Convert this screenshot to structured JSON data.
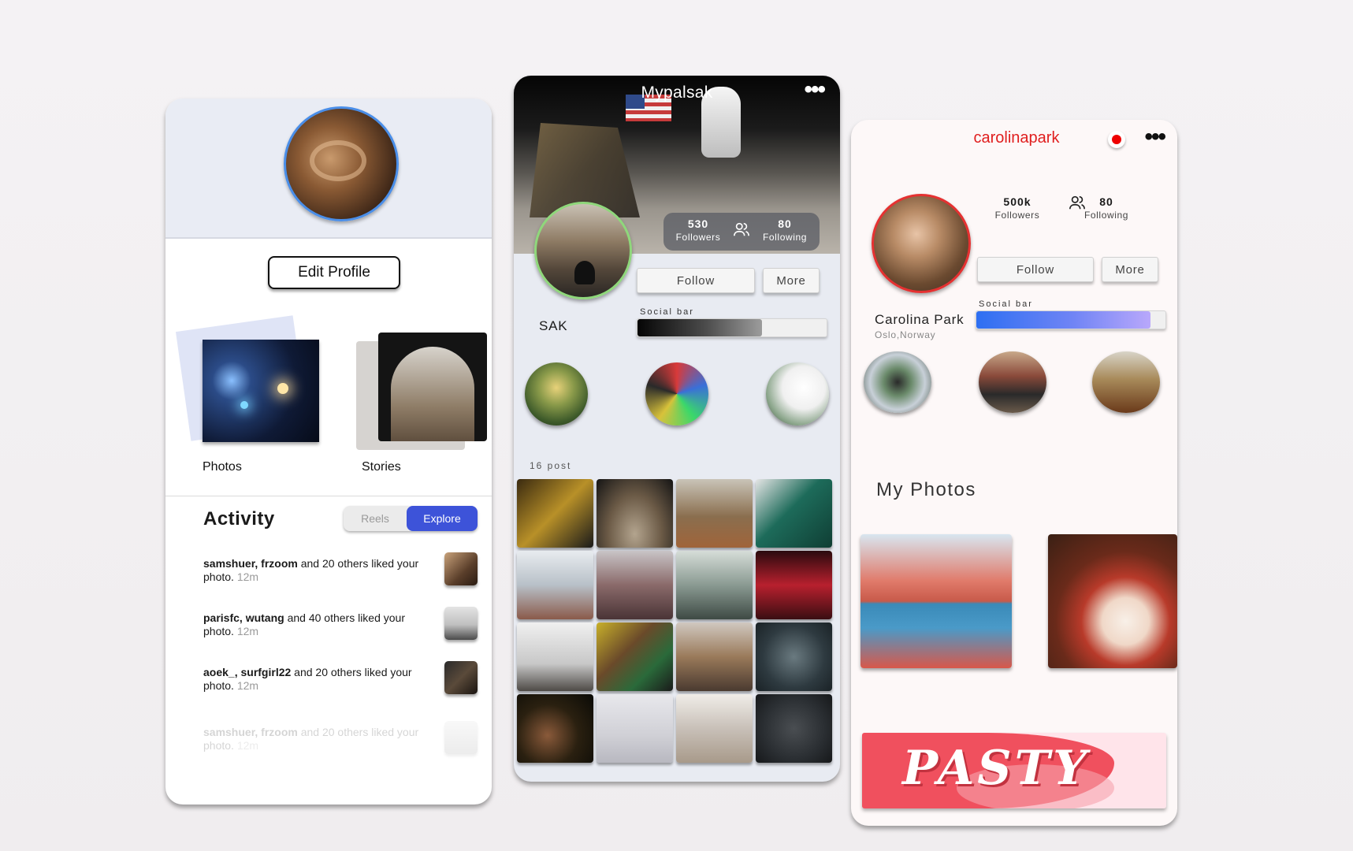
{
  "profile_edit": {
    "edit_button_label": "Edit Profile",
    "albums": [
      {
        "label": "Photos"
      },
      {
        "label": "Stories"
      }
    ],
    "activity": {
      "title": "Activity",
      "tabs": [
        {
          "label": "Reels",
          "selected": false
        },
        {
          "label": "Explore",
          "selected": true
        }
      ],
      "items": [
        {
          "users": "samshuer, frzoom",
          "rest": " and 20 others liked your photo.",
          "time": "12m"
        },
        {
          "users": "parisfc, wutang",
          "rest": " and 40 others liked your photo.",
          "time": "12m"
        },
        {
          "users": "aoek_, surfgirl22",
          "rest": " and 20 others liked your photo.",
          "time": "12m"
        },
        {
          "users": "samshuer, frzoom",
          "rest": " and 20 others liked your photo.",
          "time": "12m"
        }
      ]
    },
    "colors": {
      "accent": "#3d53d9",
      "avatar_ring": "#4a8ee8"
    }
  },
  "profile_sak": {
    "app_title": "Mypalsak",
    "menu_icon": "more-dots-icon",
    "followers_count": "530",
    "followers_label": "Followers",
    "following_count": "80",
    "following_label": "Following",
    "follow_label": "Follow",
    "more_label": "More",
    "username": "SAK",
    "social_bar_label": "Social bar",
    "social_bar_level": 0.66,
    "post_count_label": "16 post",
    "colors": {
      "avatar_ring": "#8fd77b"
    }
  },
  "profile_carolina": {
    "app_title": "carolinapark",
    "menu_icon": "more-dots-icon",
    "followers_count": "500k",
    "followers_label": "Followers",
    "following_count": "80",
    "following_label": "Following",
    "follow_label": "Follow",
    "more_label": "More",
    "name": "Carolina Park",
    "location": "Oslo,Norway",
    "social_bar_label": "Social bar",
    "social_bar_level": 0.92,
    "section_title": "My Photos",
    "banner_text": "PASTY",
    "colors": {
      "title": "#e01e1e",
      "avatar_ring": "#e53131",
      "social_bar": "#2e6ff2"
    }
  }
}
